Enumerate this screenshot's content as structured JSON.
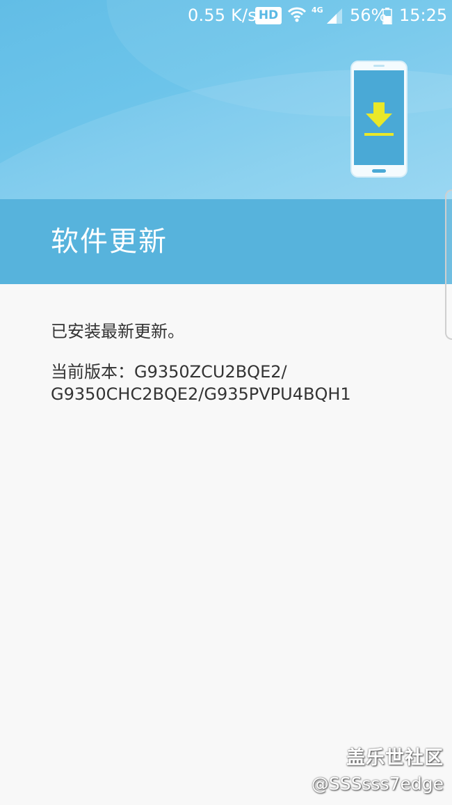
{
  "status_bar": {
    "network_speed": "0.55 K/s",
    "hd_badge": "HD",
    "network_type": "4G",
    "battery_percent": "56%",
    "time": "15:25"
  },
  "header": {
    "title": "软件更新",
    "illustration_icon": "phone-download-icon"
  },
  "content": {
    "status_message": "已安装最新更新。",
    "version_label": "当前版本：G9350ZCU2BQE2/",
    "version_line2": "G9350CHC2BQE2/G935PVPU4BQH1"
  },
  "watermark": {
    "line1": "盖乐世社区",
    "line2": "@SSSsss7edge"
  },
  "colors": {
    "hero_blue": "#6cc4ea",
    "title_band": "#57b3dc",
    "download_arrow": "#e9e829",
    "background": "#f8f8f8"
  }
}
